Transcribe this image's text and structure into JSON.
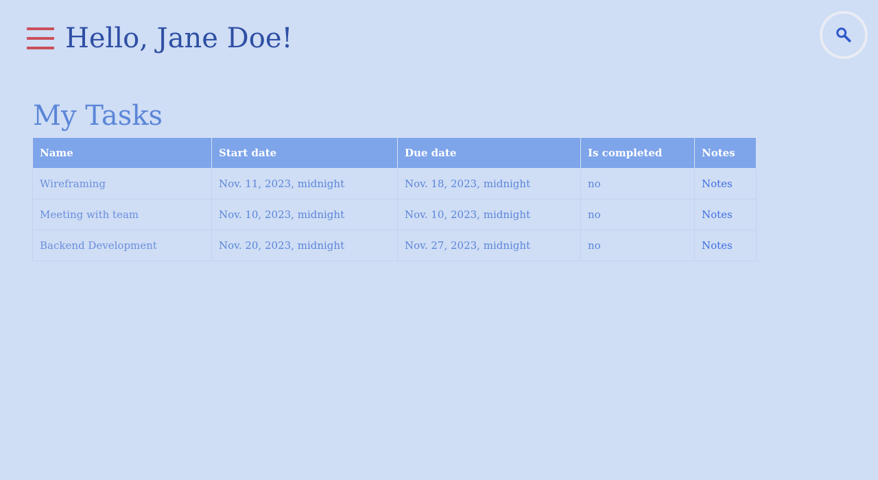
{
  "header": {
    "greeting": "Hello, Jane Doe!",
    "menu_icon": "hamburger-menu-icon",
    "search_icon": "search-icon"
  },
  "main": {
    "title": "My Tasks",
    "table": {
      "columns": [
        "Name",
        "Start date",
        "Due date",
        "Is completed",
        "Notes"
      ],
      "rows": [
        {
          "name": "Wireframing",
          "start": "Nov. 11, 2023, midnight",
          "due": "Nov. 18, 2023, midnight",
          "completed": "no",
          "notes": "Notes"
        },
        {
          "name": "Meeting with team",
          "start": "Nov. 10, 2023, midnight",
          "due": "Nov. 10, 2023, midnight",
          "completed": "no",
          "notes": "Notes"
        },
        {
          "name": "Backend Development",
          "start": "Nov. 20, 2023, midnight",
          "due": "Nov. 27, 2023, midnight",
          "completed": "no",
          "notes": "Notes"
        }
      ]
    }
  },
  "colors": {
    "background": "#cfddf5",
    "header_text": "#2e4fa3",
    "menu_icon": "#c9505a",
    "table_header": "#7ea4ea",
    "body_text": "#5b86d8",
    "link": "#3f6ee0"
  }
}
